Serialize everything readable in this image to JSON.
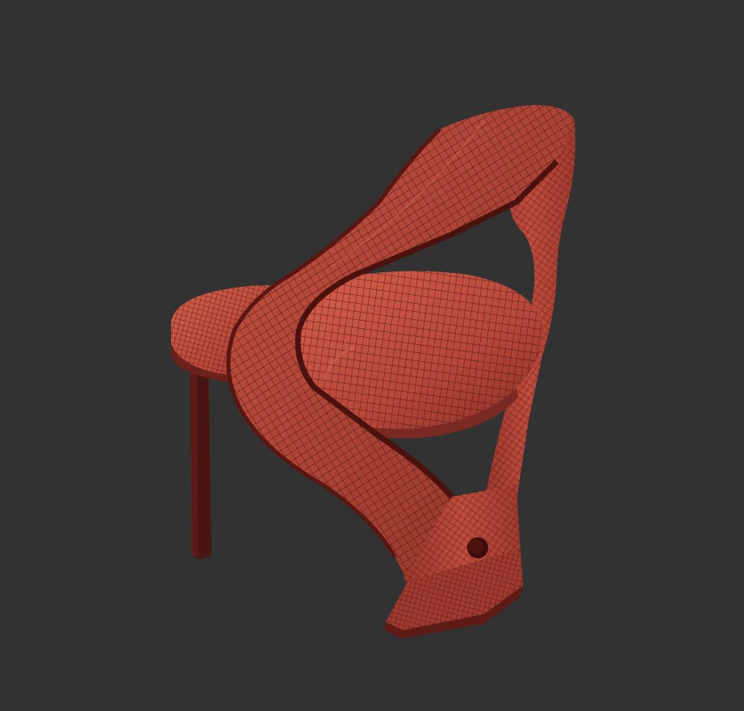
{
  "viewport": {
    "background": "#323232",
    "model": "chair-wireframe",
    "colors": {
      "surface": "#b8473a",
      "surface_light": "#d25a46",
      "surface_dark": "#7a2a22",
      "wire": "#3a0d0a",
      "leg": "#4a1410"
    }
  }
}
